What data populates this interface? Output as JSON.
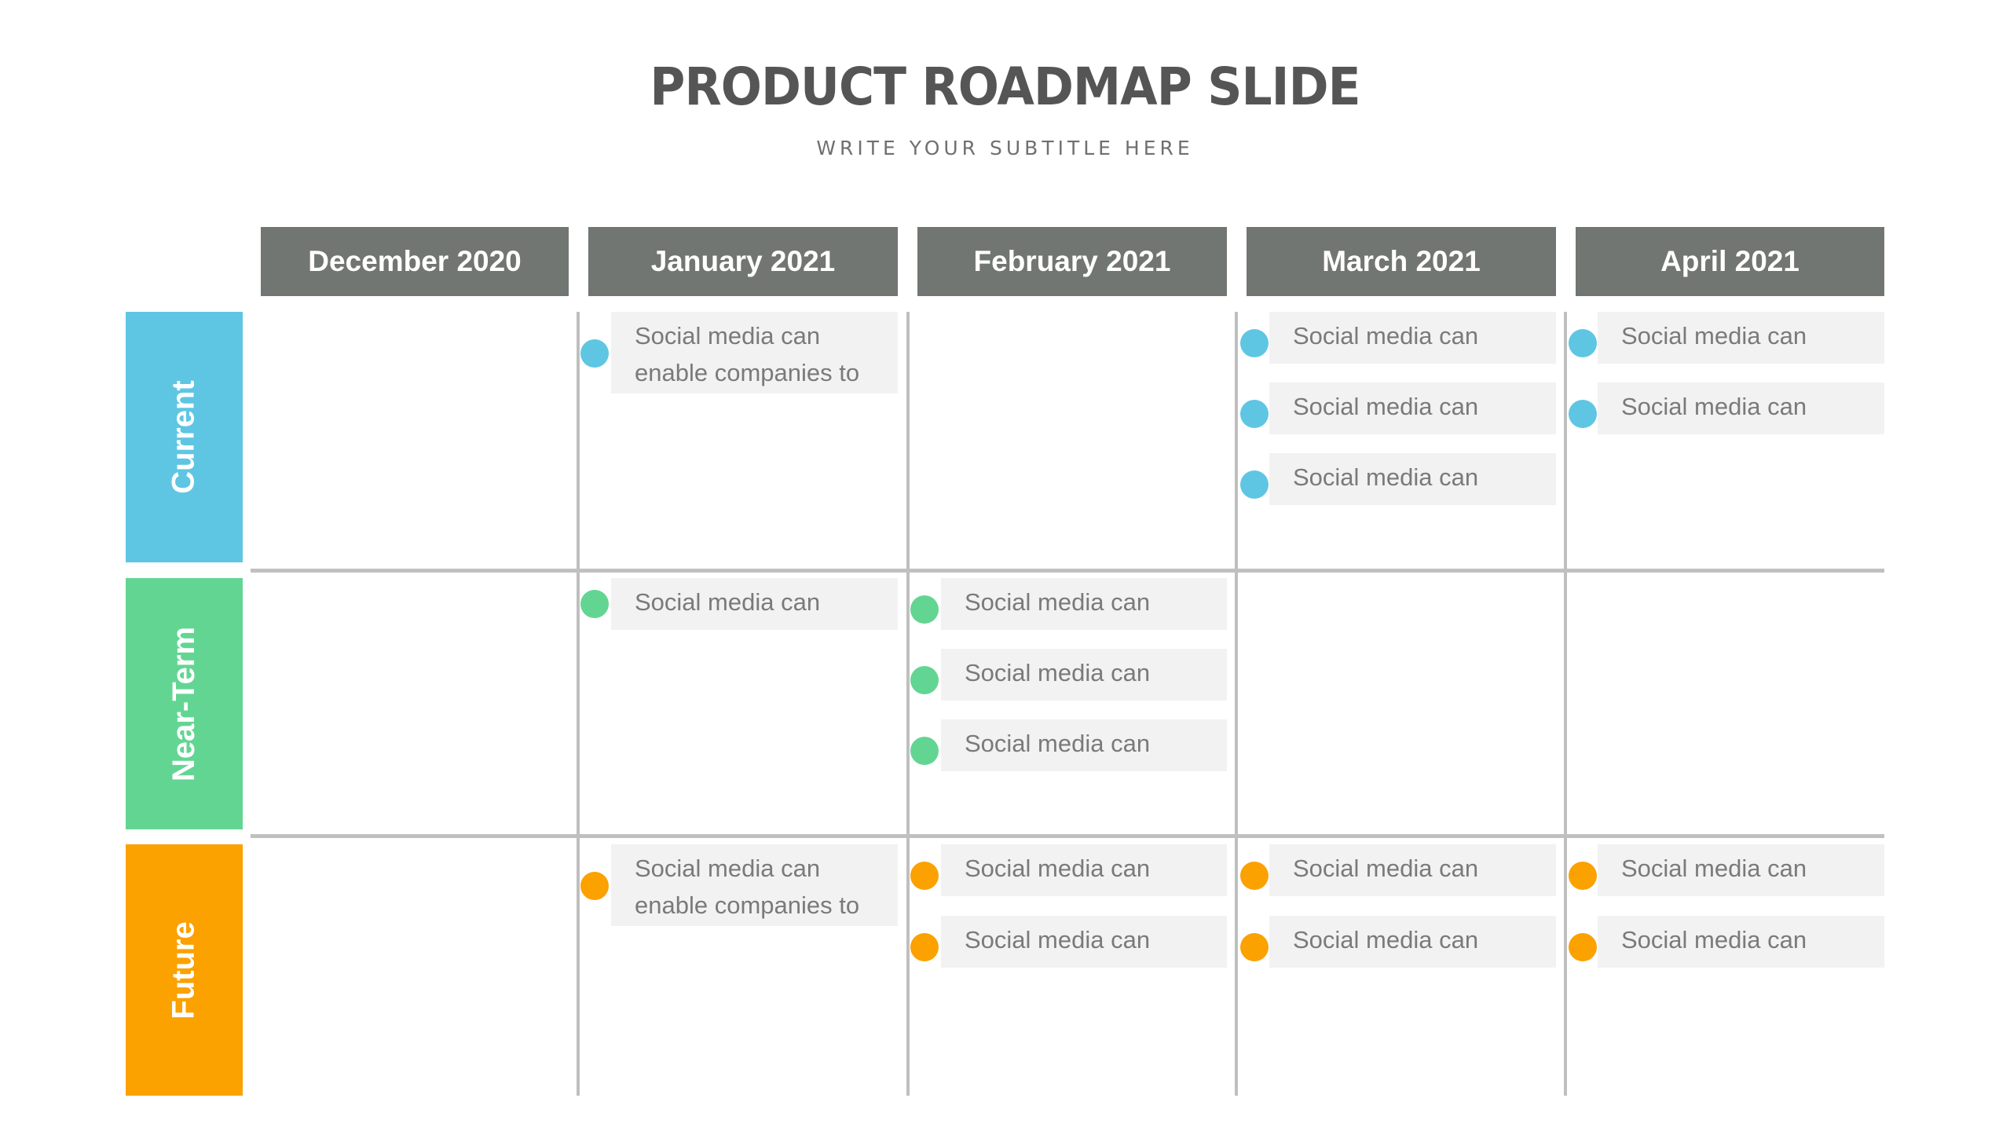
{
  "slide": {
    "title": "PRODUCT ROADMAP SLIDE",
    "subtitle": "WRITE YOUR SUBTITLE HERE"
  },
  "columns": [
    {
      "label": "December 2020"
    },
    {
      "label": "January 2021"
    },
    {
      "label": "February 2021"
    },
    {
      "label": "March 2021"
    },
    {
      "label": "April 2021"
    }
  ],
  "rows": [
    {
      "label": "Current",
      "color": "#5EC6E3"
    },
    {
      "label": "Near-Term",
      "color": "#63D593"
    },
    {
      "label": "Future",
      "color": "#FBA100"
    }
  ],
  "colors": {
    "header_bg": "#717672",
    "card_bg": "#F2F2F2",
    "card_text": "#7A7A7A",
    "grid_line": "#BFBFBF",
    "title_text": "#555555"
  },
  "cells": {
    "current": {
      "january": [
        "Social media can\nenable companies to"
      ],
      "march": [
        "Social media can",
        "Social media can",
        "Social media can"
      ],
      "april": [
        "Social media can",
        "Social media can"
      ]
    },
    "near_term": {
      "january": [
        "Social media can"
      ],
      "february": [
        "Social media can",
        "Social media can",
        "Social media can"
      ]
    },
    "future": {
      "january": [
        "Social media can\nenable companies to"
      ],
      "february": [
        "Social media can",
        "Social media can"
      ],
      "march": [
        "Social media can",
        "Social media can"
      ],
      "april": [
        "Social media can",
        "Social media can"
      ]
    }
  },
  "items": [
    {
      "row": 0,
      "col": 1,
      "slot": 0,
      "text_line1": "Social media can",
      "text_line2": "enable companies to"
    },
    {
      "row": 0,
      "col": 3,
      "slot": 0,
      "text_line1": "Social media can"
    },
    {
      "row": 0,
      "col": 3,
      "slot": 1,
      "text_line1": "Social media can"
    },
    {
      "row": 0,
      "col": 3,
      "slot": 2,
      "text_line1": "Social media can"
    },
    {
      "row": 0,
      "col": 4,
      "slot": 0,
      "text_line1": "Social media can"
    },
    {
      "row": 0,
      "col": 4,
      "slot": 1,
      "text_line1": "Social media can"
    },
    {
      "row": 1,
      "col": 1,
      "slot": 0,
      "text_line1": "Social media can"
    },
    {
      "row": 1,
      "col": 2,
      "slot": 0,
      "text_line1": "Social media can"
    },
    {
      "row": 1,
      "col": 2,
      "slot": 1,
      "text_line1": "Social media can"
    },
    {
      "row": 1,
      "col": 2,
      "slot": 2,
      "text_line1": "Social media can"
    },
    {
      "row": 2,
      "col": 1,
      "slot": 0,
      "text_line1": "Social media can",
      "text_line2": "enable companies to"
    },
    {
      "row": 2,
      "col": 2,
      "slot": 0,
      "text_line1": "Social media can"
    },
    {
      "row": 2,
      "col": 2,
      "slot": 1,
      "text_line1": "Social media can"
    },
    {
      "row": 2,
      "col": 3,
      "slot": 0,
      "text_line1": "Social media can"
    },
    {
      "row": 2,
      "col": 3,
      "slot": 1,
      "text_line1": "Social media can"
    },
    {
      "row": 2,
      "col": 4,
      "slot": 0,
      "text_line1": "Social media can"
    },
    {
      "row": 2,
      "col": 4,
      "slot": 1,
      "text_line1": "Social media can"
    }
  ]
}
